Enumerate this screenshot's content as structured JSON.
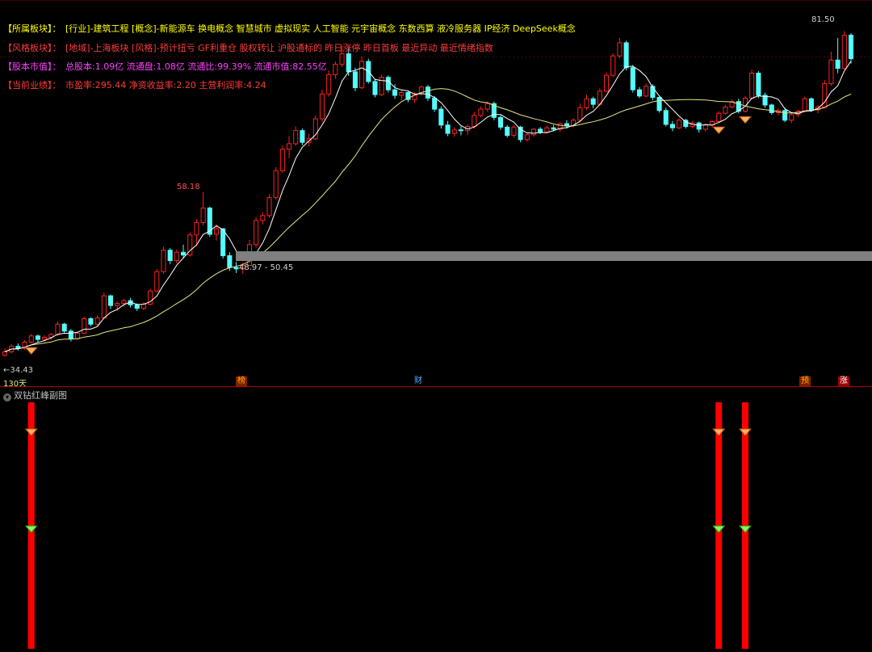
{
  "info": {
    "sector": {
      "tag": "【所属板块】：",
      "text": "[行业]-建筑工程 [概念]-新能源车 换电概念 智慧城市 虚拟现实 人工智能 元宇宙概念 东数西算 液冷服务器 IP经济 DeepSeek概念"
    },
    "style": {
      "tag": "【风格板块】：",
      "text": "[地域]-上海板块 [风格]-预计扭亏 GF利重仓 股权转让 沪股通标的 昨日涨停 昨日首板 最近异动 最近情绪指数"
    },
    "capital": {
      "tag": "【股本市值】：",
      "text": "总股本:1.09亿 流通盘:1.08亿 流通比:99.39% 流通市值:82.55亿"
    },
    "performance": {
      "tag": "【当前业绩】：",
      "text": "市盈率:295.44 净资收益率:2.20 主营利润率:4.24"
    }
  },
  "colors": {
    "up": "#ff2020",
    "down": "#54fcfc",
    "ma_short": "#ffffff",
    "ma_long": "#e6e682",
    "band": "#808080",
    "signal_bar": "#ff0000",
    "tag": "#ffff00",
    "info_text": "#ff3c3c",
    "info_text_yellow": "#ffff00",
    "info_text_magenta": "#ff40ff"
  },
  "labels": {
    "high_right": "81.50",
    "high_mid": "58.18",
    "low_left": "34.43",
    "band_range": "48.97 - 50.45",
    "period": "130天",
    "sub_title": "双钻红峰副图"
  },
  "markers": [
    {
      "text": "榜",
      "color": "#ffaa00",
      "bg": "#802000"
    },
    {
      "text": "财",
      "color": "#54b0ff",
      "bg": "#000000"
    },
    {
      "text": "预",
      "color": "#ffaa00",
      "bg": "#802000"
    },
    {
      "text": "涨",
      "color": "#ffffff",
      "bg": "#a00000"
    }
  ],
  "chart_data": {
    "type": "candlestick",
    "title": "",
    "price_range": [
      32,
      84
    ],
    "candles": [
      [
        34.6,
        35.6,
        34.4,
        35.1
      ],
      [
        35.1,
        36.2,
        34.9,
        35.9
      ],
      [
        35.9,
        36.3,
        35.3,
        35.6
      ],
      [
        35.6,
        36.8,
        35.4,
        36.5
      ],
      [
        36.5,
        37.7,
        36.3,
        37.4
      ],
      [
        37.4,
        37.6,
        36.5,
        36.9
      ],
      [
        36.9,
        37.5,
        36.6,
        37.2
      ],
      [
        37.2,
        37.8,
        36.8,
        37.6
      ],
      [
        37.6,
        39.5,
        37.4,
        39.1
      ],
      [
        39.1,
        39.3,
        37.8,
        38.1
      ],
      [
        38.1,
        38.4,
        36.6,
        37.0
      ],
      [
        37.0,
        38.0,
        36.8,
        37.8
      ],
      [
        37.8,
        40.2,
        37.7,
        39.9
      ],
      [
        39.9,
        40.1,
        38.8,
        39.1
      ],
      [
        39.1,
        40.4,
        38.8,
        40.0
      ],
      [
        40.0,
        43.7,
        39.8,
        43.2
      ],
      [
        43.2,
        43.4,
        41.3,
        41.8
      ],
      [
        41.8,
        42.4,
        41.0,
        42.1
      ],
      [
        42.1,
        42.8,
        41.6,
        42.5
      ],
      [
        42.5,
        42.9,
        41.5,
        41.9
      ],
      [
        41.9,
        42.1,
        41.0,
        41.4
      ],
      [
        41.4,
        42.3,
        41.1,
        42.0
      ],
      [
        42.0,
        44.2,
        41.8,
        43.9
      ],
      [
        43.9,
        47.1,
        43.7,
        46.7
      ],
      [
        46.7,
        50.3,
        46.4,
        49.8
      ],
      [
        49.8,
        50.1,
        47.8,
        48.3
      ],
      [
        48.3,
        49.9,
        47.9,
        49.5
      ],
      [
        49.5,
        50.6,
        48.6,
        49.1
      ],
      [
        49.1,
        52.4,
        48.9,
        52.0
      ],
      [
        52.0,
        54.3,
        50.4,
        53.8
      ],
      [
        53.8,
        58.2,
        53.4,
        55.9
      ],
      [
        55.9,
        56.1,
        51.7,
        52.1
      ],
      [
        52.1,
        53.5,
        51.2,
        52.9
      ],
      [
        52.9,
        53.0,
        48.6,
        49.0
      ],
      [
        49.0,
        49.5,
        46.8,
        47.3
      ],
      [
        47.3,
        48.1,
        46.5,
        47.1
      ],
      [
        47.1,
        48.0,
        46.4,
        47.6
      ],
      [
        47.6,
        51.3,
        47.5,
        50.6
      ],
      [
        50.6,
        54.6,
        50.2,
        54.1
      ],
      [
        54.1,
        55.3,
        53.5,
        54.8
      ],
      [
        54.8,
        57.9,
        54.5,
        57.4
      ],
      [
        57.4,
        61.8,
        57.1,
        61.3
      ],
      [
        61.3,
        64.9,
        61.0,
        64.4
      ],
      [
        64.4,
        66.3,
        63.1,
        65.2
      ],
      [
        65.2,
        67.7,
        64.9,
        67.1
      ],
      [
        67.1,
        67.4,
        65.0,
        65.4
      ],
      [
        65.4,
        66.6,
        64.8,
        65.9
      ],
      [
        65.9,
        69.3,
        65.7,
        68.8
      ],
      [
        68.8,
        73.0,
        68.3,
        72.4
      ],
      [
        72.4,
        75.8,
        72.0,
        75.2
      ],
      [
        75.2,
        77.1,
        74.6,
        76.7
      ],
      [
        76.7,
        79.4,
        76.3,
        78.2
      ],
      [
        78.2,
        79.0,
        75.0,
        75.6
      ],
      [
        75.6,
        76.2,
        72.8,
        73.3
      ],
      [
        73.3,
        77.8,
        73.1,
        77.1
      ],
      [
        77.1,
        77.5,
        73.9,
        74.2
      ],
      [
        74.2,
        74.6,
        71.9,
        72.3
      ],
      [
        72.3,
        75.2,
        72.1,
        74.8
      ],
      [
        74.8,
        75.1,
        72.6,
        73.0
      ],
      [
        73.0,
        73.8,
        71.7,
        72.2
      ],
      [
        72.2,
        73.0,
        71.5,
        72.6
      ],
      [
        72.6,
        72.9,
        71.2,
        71.6
      ],
      [
        71.6,
        72.7,
        71.1,
        72.4
      ],
      [
        72.4,
        73.6,
        72.2,
        73.4
      ],
      [
        73.4,
        73.7,
        71.4,
        71.8
      ],
      [
        71.8,
        72.1,
        69.8,
        70.2
      ],
      [
        70.2,
        70.6,
        67.4,
        67.9
      ],
      [
        67.9,
        68.5,
        66.3,
        66.7
      ],
      [
        66.7,
        67.6,
        66.2,
        67.2
      ],
      [
        67.2,
        67.7,
        66.4,
        67.1
      ],
      [
        67.1,
        68.0,
        66.5,
        67.7
      ],
      [
        67.7,
        69.8,
        67.4,
        69.3
      ],
      [
        69.3,
        70.6,
        69.0,
        70.2
      ],
      [
        70.2,
        71.3,
        69.8,
        71.0
      ],
      [
        71.0,
        71.3,
        68.6,
        69.0
      ],
      [
        69.0,
        69.3,
        67.2,
        67.6
      ],
      [
        67.6,
        67.9,
        66.1,
        66.4
      ],
      [
        66.4,
        67.9,
        66.1,
        67.6
      ],
      [
        67.6,
        67.8,
        65.4,
        65.8
      ],
      [
        65.8,
        66.8,
        65.5,
        66.5
      ],
      [
        66.5,
        67.5,
        66.2,
        67.3
      ],
      [
        67.3,
        67.6,
        66.6,
        66.9
      ],
      [
        66.9,
        67.8,
        66.7,
        67.5
      ],
      [
        67.5,
        67.9,
        67.0,
        67.3
      ],
      [
        67.3,
        68.3,
        66.9,
        68.1
      ],
      [
        68.1,
        68.6,
        67.4,
        67.8
      ],
      [
        67.8,
        68.9,
        67.6,
        68.6
      ],
      [
        68.6,
        71.0,
        68.3,
        70.4
      ],
      [
        70.4,
        72.3,
        70.1,
        71.7
      ],
      [
        71.7,
        72.0,
        70.3,
        70.9
      ],
      [
        70.9,
        73.2,
        70.7,
        72.8
      ],
      [
        72.8,
        75.5,
        72.6,
        75.1
      ],
      [
        75.1,
        78.3,
        74.8,
        77.9
      ],
      [
        77.9,
        80.5,
        77.6,
        79.8
      ],
      [
        79.8,
        80.1,
        75.8,
        76.2
      ],
      [
        76.2,
        76.6,
        72.6,
        73.0
      ],
      [
        73.0,
        73.4,
        71.8,
        72.1
      ],
      [
        72.1,
        73.9,
        71.9,
        73.5
      ],
      [
        73.5,
        73.8,
        71.5,
        71.9
      ],
      [
        71.9,
        72.0,
        69.7,
        70.0
      ],
      [
        70.0,
        70.4,
        67.7,
        68.0
      ],
      [
        68.0,
        68.5,
        67.0,
        67.5
      ],
      [
        67.5,
        68.9,
        67.3,
        68.6
      ],
      [
        68.6,
        68.8,
        67.4,
        67.7
      ],
      [
        67.7,
        68.5,
        67.5,
        68.2
      ],
      [
        68.2,
        68.4,
        66.8,
        67.3
      ],
      [
        67.3,
        68.2,
        67.0,
        67.9
      ],
      [
        67.9,
        68.6,
        67.6,
        68.4
      ],
      [
        68.4,
        69.9,
        68.2,
        69.6
      ],
      [
        69.6,
        70.8,
        69.4,
        70.5
      ],
      [
        70.5,
        71.6,
        70.3,
        71.3
      ],
      [
        71.3,
        71.7,
        69.6,
        69.9
      ],
      [
        69.9,
        72.1,
        69.7,
        71.8
      ],
      [
        71.8,
        75.9,
        71.6,
        75.4
      ],
      [
        75.4,
        75.7,
        71.8,
        72.2
      ],
      [
        72.2,
        72.6,
        70.4,
        70.8
      ],
      [
        70.8,
        71.0,
        69.4,
        69.7
      ],
      [
        69.7,
        70.3,
        69.3,
        70.0
      ],
      [
        70.0,
        70.4,
        68.3,
        68.6
      ],
      [
        68.6,
        69.7,
        68.2,
        69.4
      ],
      [
        69.4,
        70.1,
        69.1,
        69.9
      ],
      [
        69.9,
        72.0,
        69.7,
        71.7
      ],
      [
        71.7,
        71.9,
        69.8,
        70.1
      ],
      [
        70.1,
        70.8,
        69.6,
        70.5
      ],
      [
        70.5,
        74.4,
        70.3,
        73.9
      ],
      [
        73.9,
        78.5,
        73.6,
        77.3
      ],
      [
        77.3,
        80.5,
        75.4,
        76.1
      ],
      [
        76.1,
        81.5,
        75.9,
        80.9
      ],
      [
        80.9,
        81.2,
        76.8,
        77.5
      ]
    ],
    "ma_short_period": 5,
    "ma_long_period": 20,
    "signals": [
      {
        "candle": 4,
        "kind": "diamond"
      },
      {
        "candle": 108,
        "kind": "diamond"
      },
      {
        "candle": 112,
        "kind": "diamond"
      }
    ],
    "signal_bars": [
      {
        "candle": 4
      },
      {
        "candle": 108
      },
      {
        "candle": 112
      }
    ]
  }
}
